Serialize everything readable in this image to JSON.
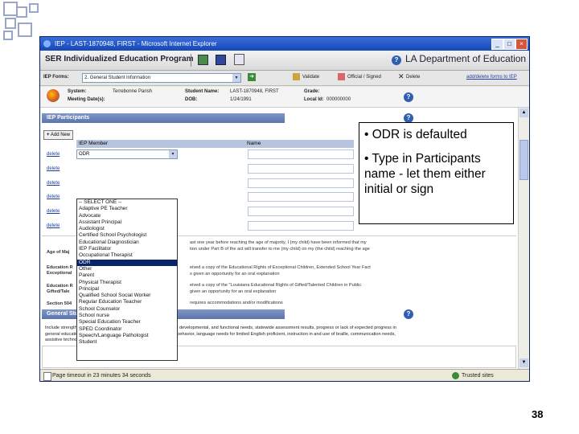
{
  "window": {
    "title": "IEP - LAST-1870948, FIRST - Microsoft Internet Explorer",
    "min": "_",
    "max": "□",
    "close": "×"
  },
  "banner": {
    "app_title": "SER Individualized Education Program",
    "dept": "LA Department of Education",
    "help": "?"
  },
  "toolbar": {
    "iep_forms_label": "IEP Forms:",
    "iep_forms_value": "2. General Student Information",
    "validate": "Validate",
    "official": "Official / Signed",
    "delete": "Delete",
    "add_delete_forms": "add/delete forms to IEP"
  },
  "info": {
    "system_label": "System:",
    "system_value": "Terrebonne Parish",
    "student_label": "Student Name:",
    "student_value": "LAST-1870948, FIRST",
    "grade_label": "Grade:",
    "meeting_label": "Meeting Date(s):",
    "dob_label": "DOB:",
    "dob_value": "1/24/1991",
    "local_label": "Local Id:",
    "local_value": "000000000"
  },
  "participants": {
    "section_title": "IEP Participants",
    "add_new": "Add New",
    "col_member": "IEP Member",
    "col_name": "Name",
    "delete_label": "delete",
    "selected_value": "ODR",
    "options": [
      "-- SELECT ONE --",
      "Adaptive PE Teacher",
      "Advocate",
      "Assistant Principal",
      "Audiologist",
      "Certified School Psychologist",
      "Educational Diagnostician",
      "IEP Facilitator",
      "Occupational Therapist",
      "ODR",
      "Other",
      "Parent",
      "Physical Therapist",
      "Principal",
      "Qualified School Social Worker",
      "Regular Education Teacher",
      "School Counselor",
      "School nurse",
      "Special Education Teacher",
      "SPED Coordinator",
      "Speech/Language Pathologist",
      "Student"
    ]
  },
  "paragraphs": {
    "age_major": "Age of Maj",
    "line1": "ast one year before reaching the age of majority, I (my child) have been informed that my",
    "line2": "tion under Part B of the act will transfer to me (my child) on my (the child) reaching the age",
    "edu_a": "Education R",
    "exc_a": "Exceptional",
    "line3": "eived a copy of the Educational Rights of Exceptional Children, Extended School Year Fact",
    "line4": "s given an opportunity for an oral explanation",
    "edu_b": "Education R",
    "gift_b": "Gifted/Tale",
    "line5": "eived a copy of the \"Louisiana Educational Rights of Gifted/Talented Children in Public",
    "line6": "given an opportunity for an oral explanation",
    "sec504": "Section 504",
    "line7": "requires accommodations and/or modifications"
  },
  "general": {
    "section_title": "General Student Information",
    "text1": "Include strengths, parental concerns, evaluation results, academic, developmental, and functional needs, statewide assessment results, progress or lack of expected progress in",
    "text2": "general education curriculum and consideration of special factors: behavior, language needs for limited English proficient, instruction in and use of braille, communication needs,",
    "text3": "assistive technology devices and services, and health needs."
  },
  "status": {
    "left": "Page timeout in 23 minutes 34 seconds",
    "right": "Trusted sites"
  },
  "callout": {
    "bullet1": "• ODR is defaulted",
    "bullet2": "• Type in Participants name - let them either initial or sign"
  },
  "page_number": "38",
  "colors": {
    "titlebar": "#1547b8",
    "section_header": "#5a74ad",
    "selected_option": "#0a246a",
    "deco_squares": "#9aa6c8"
  }
}
